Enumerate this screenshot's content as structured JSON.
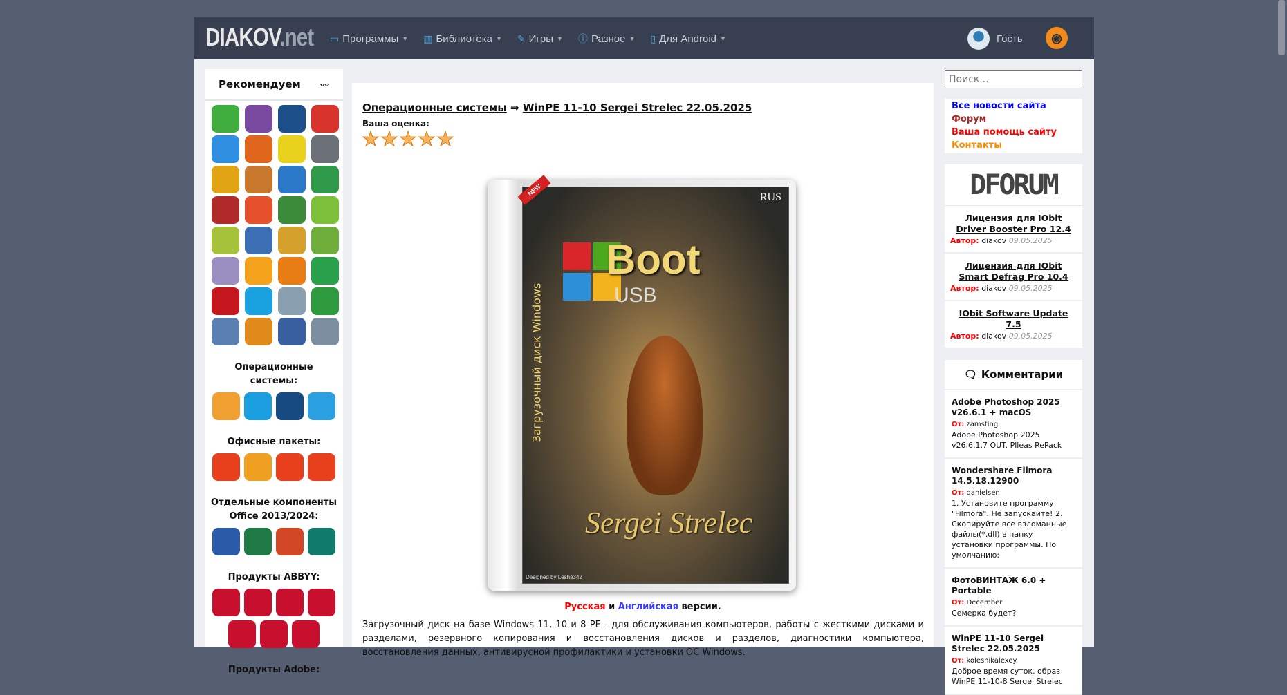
{
  "header": {
    "logo_main": "DIAKOV",
    "logo_tld": ".net",
    "nav": [
      {
        "label": "Программы",
        "icon": "monitor-icon"
      },
      {
        "label": "Библиотека",
        "icon": "book-icon"
      },
      {
        "label": "Игры",
        "icon": "gamepad-icon"
      },
      {
        "label": "Разное",
        "icon": "info-icon"
      },
      {
        "label": "Для Android",
        "icon": "phone-icon"
      }
    ],
    "user": "Гость"
  },
  "left": {
    "title": "Рекомендуем",
    "recommended_icons": [
      "usb-arrow",
      "winrar",
      "floppy",
      "ccleaner",
      "play",
      "firefox",
      "the-bat",
      "sidebar-app",
      "aimp",
      "folder-app",
      "registry",
      "pie-app",
      "aida64",
      "flash-app",
      "idm",
      "kmplayer",
      "parrot-app",
      "brush-app",
      "magic-app",
      "utorrent",
      "dvd",
      "speed-gauge",
      "foxit-pdf",
      "partition",
      "driver-booster",
      "skype",
      "trash",
      "backup",
      "disk-tool",
      "pc-restore",
      "disk-burn",
      "hdd-tool"
    ],
    "sections": [
      {
        "title": "Операционные системы:",
        "icons": [
          "windows-xp",
          "windows-10",
          "windows-8",
          "windows-11"
        ]
      },
      {
        "title": "Офисные пакеты:",
        "icons": [
          "office-2007",
          "office-2010",
          "office-2013",
          "office-2016"
        ]
      },
      {
        "title": "Отдельные компоненты Office 2013/2024:",
        "icons": [
          "word",
          "excel",
          "powerpoint",
          "publisher"
        ]
      },
      {
        "title": "Продукты ABBYY:",
        "icons": [
          "abbyy-1",
          "abbyy-2",
          "abbyy-3",
          "abbyy-4",
          "abbyy-5",
          "abbyy-6",
          "abbyy-7"
        ]
      },
      {
        "title": "Продукты Adobe:",
        "icons": []
      }
    ]
  },
  "main": {
    "category": "Операционные системы",
    "arrow": "⇒",
    "title": "WinPE 11-10 Sergei Strelec 22.05.2025",
    "rating_label": "Ваша оценка:",
    "stars": 5,
    "cover": {
      "badge": "NEW",
      "lang": "RUS",
      "boot": "Boot",
      "usb": "USB",
      "vertical": "Загрузочный диск Windows",
      "signature": "Sergei Strelec",
      "designer": "Designed by Lesha342"
    },
    "versions": {
      "ru": "Русская",
      "and": " и ",
      "en": "Английская",
      "tail": " версии."
    },
    "description": "Загрузочный диск на базе Windows 11, 10 и 8 PE - для обслуживания компьютеров, работы с жесткими дисками и разделами, резервного копирования и восстановления дисков и разделов, диагностики компьютера, восстановления данных, антивирусной профилактики и установки ОС Windows."
  },
  "right": {
    "search_placeholder": "Поиск...",
    "links": [
      {
        "label": "Все новости сайта",
        "color": "#0000ff"
      },
      {
        "label": "Форум",
        "color": "#a52a2a"
      },
      {
        "label": "Ваша помощь сайту",
        "color": "#ff0000"
      },
      {
        "label": "Контакты",
        "color": "#ff8c00"
      }
    ],
    "forum_logo": "DFORUM",
    "forum": [
      {
        "title": "Лицензия для IObit Driver Booster Pro 12.4",
        "author_label": "Автор:",
        "author": "diakov",
        "date": "09.05.2025"
      },
      {
        "title": "Лицензия для IObit Smart Defrag Pro 10.4",
        "author_label": "Автор:",
        "author": "diakov",
        "date": "09.05.2025"
      },
      {
        "title": "IObit Software Update 7.5",
        "author_label": "Автор:",
        "author": "diakov",
        "date": "09.05.2025"
      }
    ],
    "comments_title": "Комментарии",
    "comments": [
      {
        "title": "Adobe Photoshop 2025 v26.6.1 + macOS",
        "from_label": "От:",
        "from": "zamsting",
        "text": "Adobe Photoshop 2025 v26.6.1.7 OUT. Plleas RePack"
      },
      {
        "title": "Wondershare Filmora 14.5.18.12900",
        "from_label": "От:",
        "from": "danielsen",
        "text": "1. Установите программу \"Filmora\". Не запускайте! 2. Скопируйте все взломанные файлы(*.dll) в папку установки программы. По умолчанию:"
      },
      {
        "title": "ФотоВИНТАЖ 6.0 + Portable",
        "from_label": "От:",
        "from": "December",
        "text": "Семерка будет?"
      },
      {
        "title": "WinPE 11-10 Sergei Strelec 22.05.2025",
        "from_label": "От:",
        "from": "kolesnikalexey",
        "text": "Доброе время суток. образ WinPE 11-10-8 Sergei Strelec"
      }
    ]
  }
}
